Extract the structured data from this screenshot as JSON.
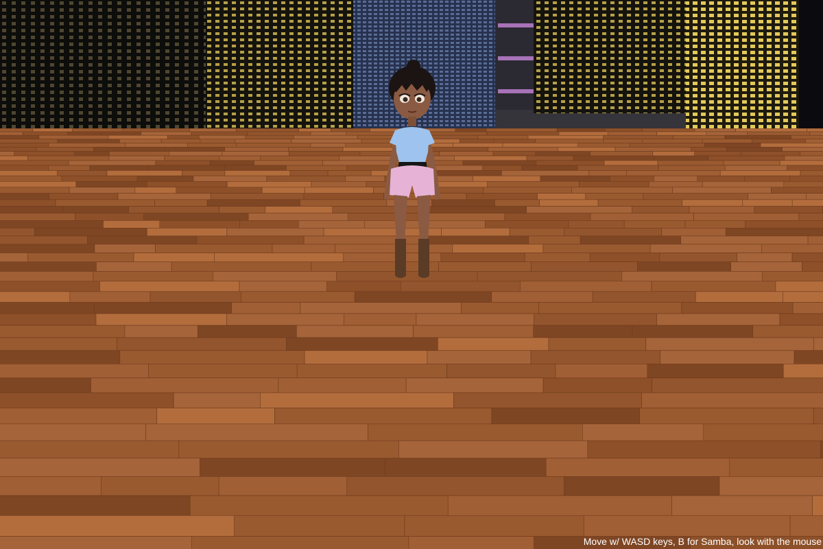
{
  "game": {
    "title": "",
    "hud": {
      "controls_hint": "Move w/ WASD keys, B for Samba, look with the mouse"
    },
    "scene": {
      "floor": "wood-parquet",
      "backdrop": "night-city-skyline",
      "character": "girl-avatar"
    }
  },
  "palette": {
    "floor_base": "#9a5a30",
    "floor_dark": "#6e3b1c",
    "floor_light": "#b36d3d",
    "shirt": "#9dc3ee",
    "shorts": "#e6b3d6",
    "hair": "#1b1413",
    "skin": "#8a5a42",
    "boots": "#5a3b26",
    "window_yellow": "#e3c95a",
    "window_blue": "#5a6c96",
    "window_purple": "#a772b8"
  }
}
